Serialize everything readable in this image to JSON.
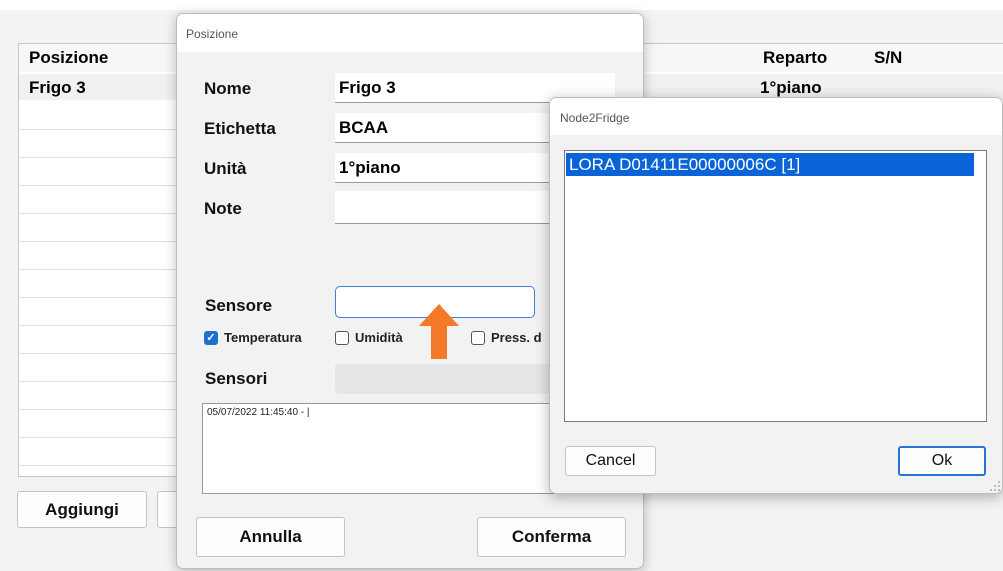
{
  "background": {
    "columns": {
      "posizione": "Posizione",
      "reparto": "Reparto",
      "sn": "S/N"
    },
    "row1": {
      "posizione": "Frigo 3",
      "reparto": "1°piano"
    },
    "add_button": "Aggiungi"
  },
  "posizione_dialog": {
    "title": "Posizione",
    "fields": {
      "nome_label": "Nome",
      "nome_value": "Frigo 3",
      "etichetta_label": "Etichetta",
      "etichetta_value": "BCAA",
      "unita_label": "Unità",
      "unita_value": "1°piano",
      "note_label": "Note",
      "note_value": "",
      "sensore_label": "Sensore",
      "sensore_value": "",
      "sensori_label": "Sensori",
      "sensori_value": ""
    },
    "checkboxes": {
      "temperatura": {
        "label": "Temperatura",
        "checked": true
      },
      "umidita": {
        "label": "Umidità",
        "checked": false
      },
      "pressione": {
        "label": "Press. d",
        "checked": false
      }
    },
    "log_text": "05/07/2022 11:45:40 - |",
    "cancel_button": "Annulla",
    "confirm_button": "Conferma"
  },
  "node_dialog": {
    "title": "Node2Fridge",
    "items": [
      "LORA D01411E00000006C [1]"
    ],
    "selected_index": 0,
    "cancel_button": "Cancel",
    "ok_button": "Ok"
  },
  "colors": {
    "accent": "#0a64d8",
    "arrow": "#f47a2a",
    "checkbox": "#1e6fd0"
  }
}
